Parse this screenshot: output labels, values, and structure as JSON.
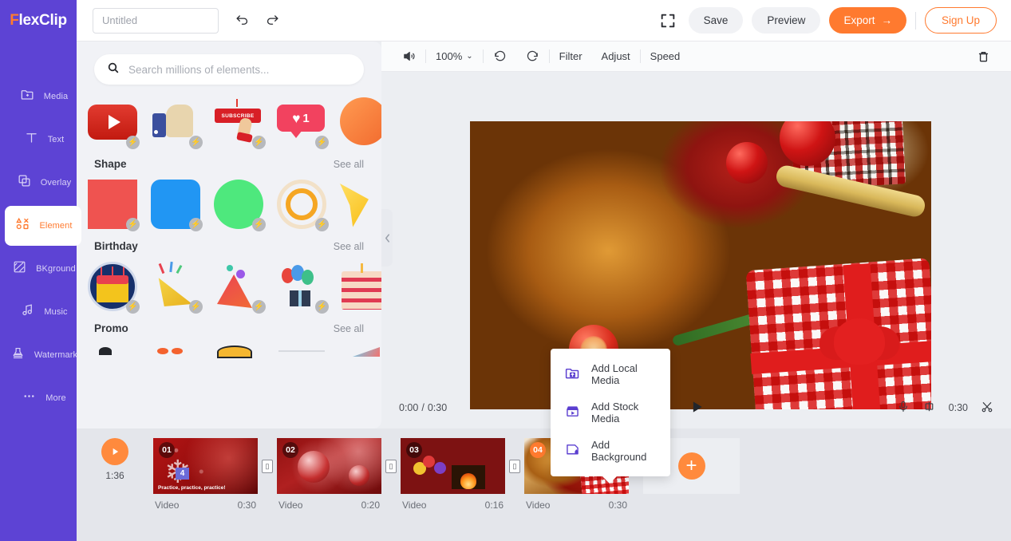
{
  "header": {
    "logo_f": "F",
    "logo_rest": "lexClip",
    "title_placeholder": "Untitled",
    "title_value": "",
    "undo_icon": "undo-icon",
    "redo_icon": "redo-icon",
    "fullscreen_icon": "fullscreen-icon",
    "save_label": "Save",
    "preview_label": "Preview",
    "export_label": "Export",
    "export_arrow": "→",
    "signup_label": "Sign Up"
  },
  "sidebar": {
    "items": [
      {
        "label": "Media",
        "icon": "media-folder-icon",
        "active": false
      },
      {
        "label": "Text",
        "icon": "text-icon",
        "active": false
      },
      {
        "label": "Overlay",
        "icon": "overlay-icon",
        "active": false
      },
      {
        "label": "Element",
        "icon": "element-shapes-icon",
        "active": true
      },
      {
        "label": "BKground",
        "icon": "background-icon",
        "active": false
      },
      {
        "label": "Music",
        "icon": "music-note-icon",
        "active": false
      },
      {
        "label": "Watermark",
        "icon": "watermark-stamp-icon",
        "active": false
      },
      {
        "label": "More",
        "icon": "more-dots-icon",
        "active": false
      }
    ]
  },
  "panel": {
    "search_placeholder": "Search millions of elements...",
    "search_value": "",
    "search_icon": "search-icon",
    "see_all_label": "See all",
    "sections": [
      {
        "title": "",
        "items": [
          {
            "name": "youtube-play-element"
          },
          {
            "name": "thumbs-up-element"
          },
          {
            "name": "subscribe-button-element"
          },
          {
            "name": "heart-like-element",
            "badge_count": "1"
          },
          {
            "name": "orange-circle-element"
          }
        ]
      },
      {
        "title": "Shape",
        "items": [
          {
            "name": "red-square-shape",
            "color": "#ef5350"
          },
          {
            "name": "blue-rounded-shape",
            "color": "#2196f3"
          },
          {
            "name": "green-circle-shape",
            "color": "#4ee87d"
          },
          {
            "name": "orange-ring-shape",
            "color": "#f5a623"
          },
          {
            "name": "yellow-star-shape",
            "color": "#ffd21e"
          }
        ]
      },
      {
        "title": "Birthday",
        "items": [
          {
            "name": "birthday-cake-element"
          },
          {
            "name": "party-popper-element"
          },
          {
            "name": "party-hat-element"
          },
          {
            "name": "balloons-gift-element"
          },
          {
            "name": "candle-cake-element"
          }
        ]
      },
      {
        "title": "Promo",
        "items": []
      }
    ]
  },
  "canvas": {
    "toolbar": {
      "volume_icon": "volume-icon",
      "zoom_level": "100%",
      "zoom_caret": "⌄",
      "rotate_left_icon": "rotate-left-icon",
      "rotate_right_icon": "rotate-right-icon",
      "filter_label": "Filter",
      "adjust_label": "Adjust",
      "speed_label": "Speed",
      "delete_icon": "trash-icon"
    },
    "playbar": {
      "current_time": "0:00",
      "separator": "/",
      "total_time": "0:30",
      "play_icon": "play-icon",
      "mic_icon": "microphone-icon",
      "crop_icon": "crop-icon",
      "clip_duration": "0:30",
      "scissors_icon": "scissors-icon"
    }
  },
  "popup_menu": {
    "items": [
      {
        "label": "Add Local Media",
        "icon": "folder-upload-icon"
      },
      {
        "label": "Add Stock Media",
        "icon": "storefront-icon"
      },
      {
        "label": "Add Background",
        "icon": "background-droplet-icon"
      }
    ]
  },
  "timeline": {
    "play_icon": "play-icon",
    "total_duration": "1:36",
    "transition_icon": "transition-icon",
    "add_icon": "plus-icon",
    "clips": [
      {
        "number": "01",
        "type_label": "Video",
        "duration": "0:30",
        "caption": "Practice, practice, practice!",
        "badge": "4",
        "selected": false
      },
      {
        "number": "02",
        "type_label": "Video",
        "duration": "0:20",
        "caption": "",
        "badge": "",
        "selected": false
      },
      {
        "number": "03",
        "type_label": "Video",
        "duration": "0:16",
        "caption": "",
        "badge": "",
        "selected": false
      },
      {
        "number": "04",
        "type_label": "Video",
        "duration": "0:30",
        "caption": "",
        "badge": "",
        "selected": true
      }
    ]
  },
  "colors": {
    "brand_purple": "#5d43d4",
    "accent_orange": "#ff7a2f",
    "panel_bg": "#f1f2f6",
    "timeline_bg": "#e4e6eb"
  }
}
